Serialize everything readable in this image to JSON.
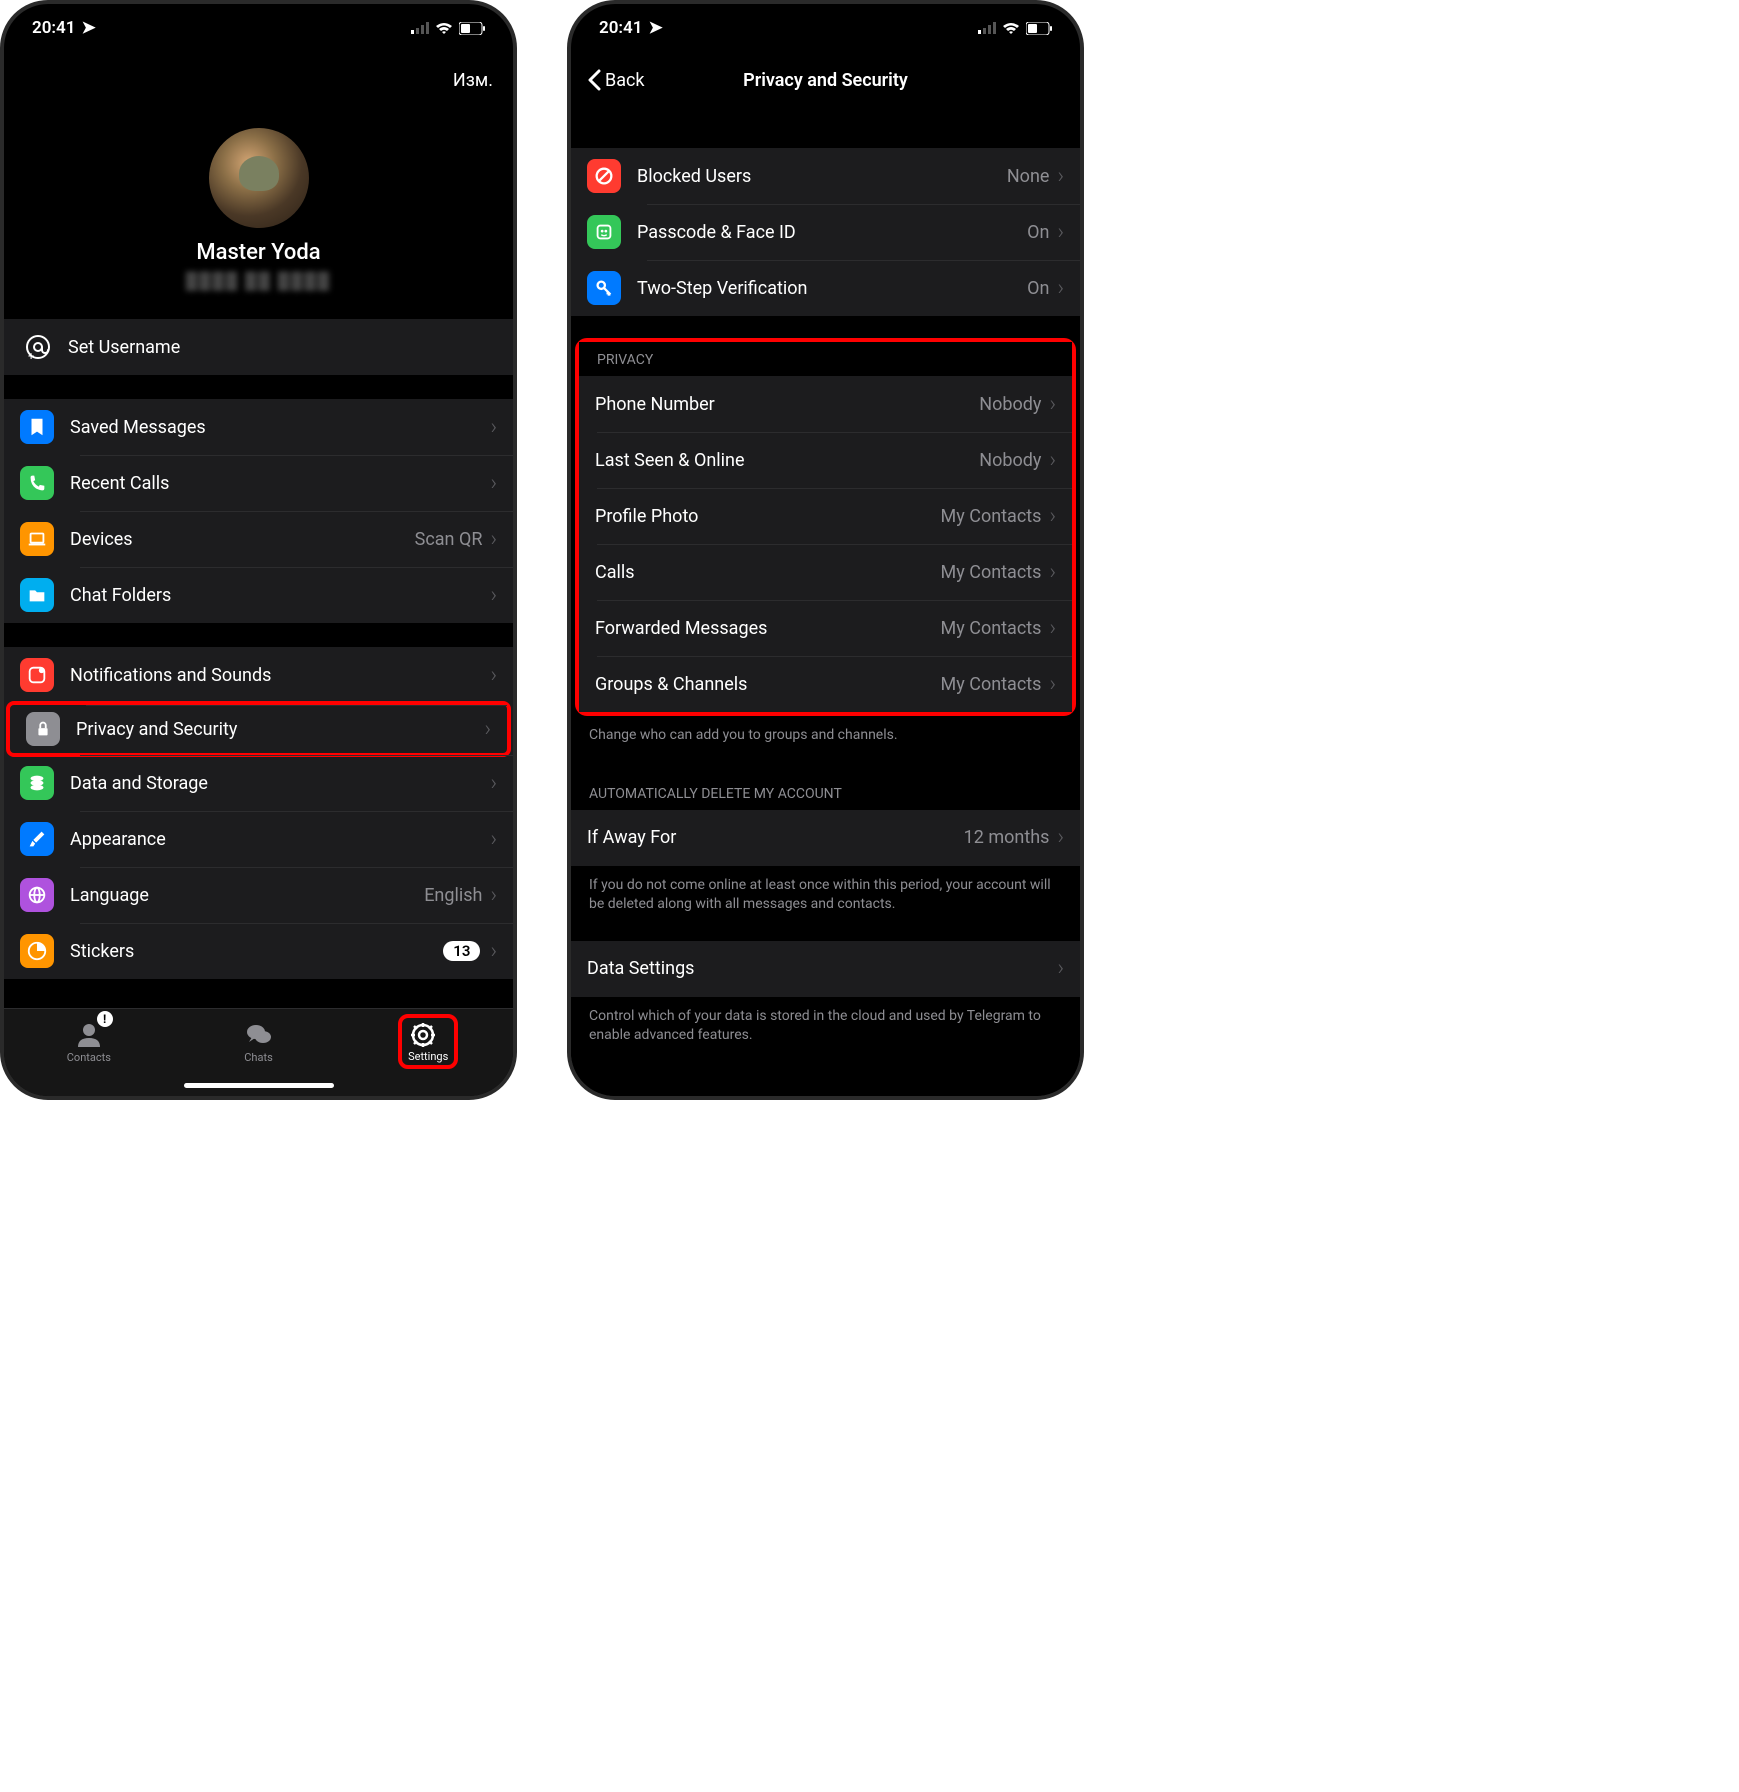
{
  "status": {
    "time": "20:41"
  },
  "left": {
    "edit": "Изм.",
    "profile_name": "Master Yoda",
    "set_username": "Set Username",
    "group2": [
      {
        "icon": "bookmark",
        "color": "#007aff",
        "label": "Saved Messages"
      },
      {
        "icon": "phone",
        "color": "#34c759",
        "label": "Recent Calls"
      },
      {
        "icon": "laptop",
        "color": "#ff9500",
        "label": "Devices",
        "value": "Scan QR"
      },
      {
        "icon": "folder",
        "color": "#00aeef",
        "label": "Chat Folders"
      }
    ],
    "group3": [
      {
        "icon": "bell",
        "color": "#ff3b30",
        "label": "Notifications and Sounds"
      },
      {
        "icon": "lock",
        "color": "#8e8e93",
        "label": "Privacy and Security",
        "highlight": true
      },
      {
        "icon": "data",
        "color": "#34c759",
        "label": "Data and Storage"
      },
      {
        "icon": "brush",
        "color": "#007aff",
        "label": "Appearance"
      },
      {
        "icon": "globe",
        "color": "#af52de",
        "label": "Language",
        "value": "English"
      },
      {
        "icon": "sticker",
        "color": "#ff9500",
        "label": "Stickers",
        "badge": "13"
      }
    ],
    "tabs": {
      "contacts": "Contacts",
      "chats": "Chats",
      "settings": "Settings",
      "badge": "!"
    }
  },
  "right": {
    "back": "Back",
    "title": "Privacy and Security",
    "group1": [
      {
        "icon": "block",
        "color": "#ff3b30",
        "label": "Blocked Users",
        "value": "None"
      },
      {
        "icon": "face",
        "color": "#34c759",
        "label": "Passcode & Face ID",
        "value": "On"
      },
      {
        "icon": "key",
        "color": "#007aff",
        "label": "Two-Step Verification",
        "value": "On"
      }
    ],
    "privacy_header": "PRIVACY",
    "privacy": [
      {
        "label": "Phone Number",
        "value": "Nobody"
      },
      {
        "label": "Last Seen & Online",
        "value": "Nobody"
      },
      {
        "label": "Profile Photo",
        "value": "My Contacts"
      },
      {
        "label": "Calls",
        "value": "My Contacts"
      },
      {
        "label": "Forwarded Messages",
        "value": "My Contacts"
      },
      {
        "label": "Groups & Channels",
        "value": "My Contacts"
      }
    ],
    "privacy_footer": "Change who can add you to groups and channels.",
    "auto_header": "AUTOMATICALLY DELETE MY ACCOUNT",
    "auto_row": {
      "label": "If Away For",
      "value": "12 months"
    },
    "auto_footer": "If you do not come online at least once within this period, your account will be deleted along with all messages and contacts.",
    "data_row": {
      "label": "Data Settings"
    },
    "data_footer": "Control which of your data is stored in the cloud and used by Telegram to enable advanced features."
  }
}
